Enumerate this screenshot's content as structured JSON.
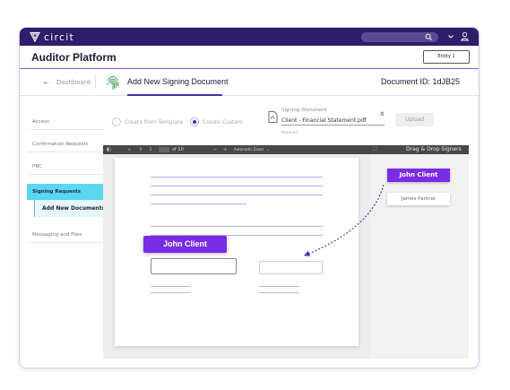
{
  "topbar": {
    "brand": "circit",
    "colors": {
      "bar": "#2d1d6b",
      "accent": "#4b2db5",
      "chip": "#7a2be6",
      "active_nav": "#5ad6ee"
    },
    "icons": [
      "circit-shield-icon",
      "search-icon",
      "chevron-down-icon",
      "user-icon"
    ]
  },
  "header": {
    "title": "Auditor Platform",
    "entity_button": "Entity 1"
  },
  "nav": {
    "back_label": "Dashboard",
    "page_title": "Add New Signing Document",
    "document_id": "Document ID: 1dJB25"
  },
  "sidebar": {
    "items": [
      {
        "label": "Access"
      },
      {
        "label": "Confirmation Requests"
      },
      {
        "label": "PBC"
      },
      {
        "label": "Signing Requests"
      },
      {
        "label": "Add New Documents"
      },
      {
        "label": "Messaging and Files"
      }
    ]
  },
  "form": {
    "option_template": "Create from Template",
    "option_custom": "Create Custom",
    "selected_option": "Create Custom",
    "signing_label": "Signing Document",
    "file_value": "Client - Financial Statement.pdf",
    "required_text": "Required",
    "close_label": "x",
    "upload_label": "Upload"
  },
  "viewer": {
    "page_counter": "of 10",
    "zoom_minus": "−",
    "zoom_plus": "+",
    "zoom_value": "Automatic Zoom",
    "zoom_caret": "⌄"
  },
  "drag_drop": {
    "title": "Drag & Drop Signers",
    "signers": [
      "John Client",
      "James Partner"
    ],
    "dragging_label": "John Client"
  }
}
